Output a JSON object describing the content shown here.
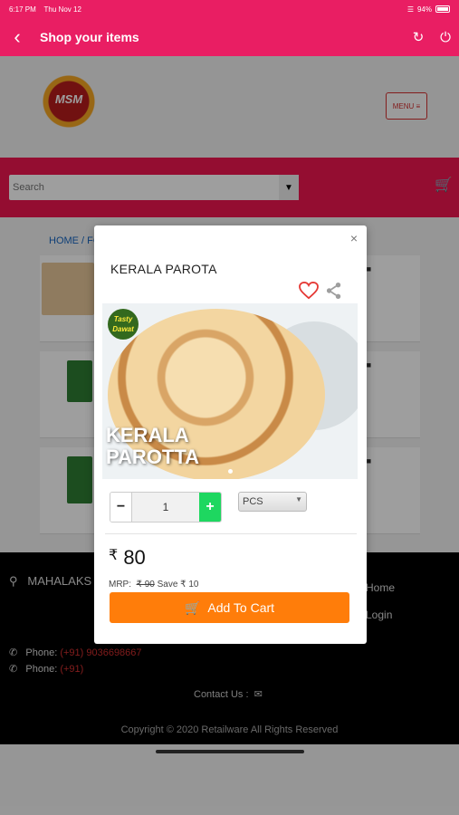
{
  "status_bar": {
    "time": "6:17 PM",
    "date": "Thu Nov 12",
    "battery": "94%"
  },
  "app_bar": {
    "title": "Shop your items"
  },
  "header": {
    "logo_text": "MSM",
    "menu_label": "MENU ≡"
  },
  "search": {
    "placeholder": "Search"
  },
  "breadcrumb": "HOME / FO",
  "footer": {
    "address": "MAHALAKS",
    "links": [
      "Home",
      "Login"
    ],
    "phone1_label": "Phone: ",
    "phone1_number": "(+91) 9036698667",
    "phone2_label": "Phone: ",
    "phone2_number": "(+91)",
    "contact_label": "Contact Us :",
    "copyright": "Copyright © 2020 Retailware All Rights Reserved"
  },
  "modal": {
    "product_name": "KERALA PAROTA",
    "image_badge": "Tasty Dawat",
    "image_title_line1": "KERALA",
    "image_title_line2": "PAROTTA",
    "quantity": "1",
    "unit": "PCS",
    "currency": "₹",
    "price": "80",
    "mrp_label": "MRP:",
    "mrp_value": "₹ 90",
    "save_text": "Save ₹ 10",
    "add_to_cart_label": "Add To Cart",
    "close_symbol": "×"
  },
  "colors": {
    "brand": "#e91e63",
    "accent": "#ff7d0a",
    "plus": "#1ed760"
  }
}
